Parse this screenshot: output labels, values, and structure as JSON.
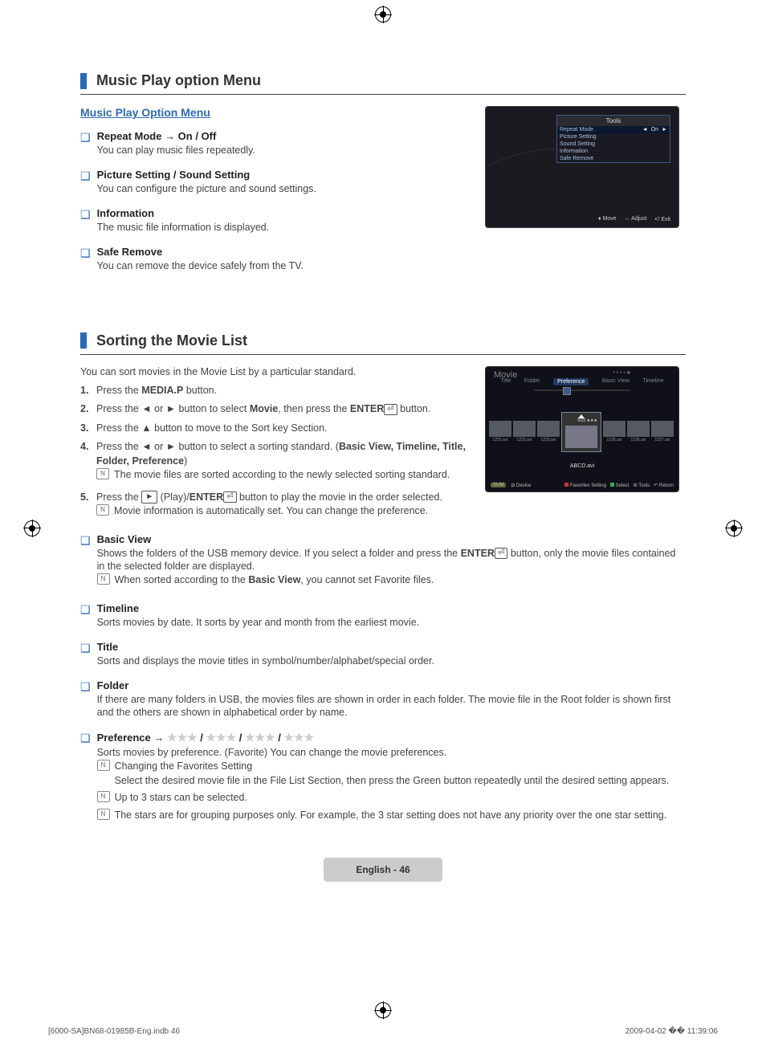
{
  "section1": {
    "title": "Music Play option Menu",
    "subtitle": "Music Play Option Menu",
    "items": [
      {
        "title": "Repeat Mode → On / Off",
        "desc": "You can play music files repeatedly."
      },
      {
        "title": "Picture Setting / Sound Setting",
        "desc": "You can configure the picture and sound settings."
      },
      {
        "title": "Information",
        "desc": "The music file information is displayed."
      },
      {
        "title": "Safe Remove",
        "desc": "You can remove the device safely from the TV."
      }
    ]
  },
  "tools_shot": {
    "header": "Tools",
    "rows": [
      {
        "label": "Repeat Mode",
        "value": "On",
        "selected": true
      },
      {
        "label": "Picture Setting",
        "value": "",
        "selected": false
      },
      {
        "label": "Sound Setting",
        "value": "",
        "selected": false
      },
      {
        "label": "Information",
        "value": "",
        "selected": false
      },
      {
        "label": "Safe Remove",
        "value": "",
        "selected": false
      }
    ],
    "footer": {
      "move": "Move",
      "adjust": "Adjust",
      "exit": "Exit"
    }
  },
  "section2": {
    "title": "Sorting the Movie List",
    "intro": "You can sort movies in the Movie List by a particular standard.",
    "steps": {
      "s1": {
        "num": "1.",
        "text_a": "Press the ",
        "b1": "MEDIA.P",
        "text_b": " button."
      },
      "s2": {
        "num": "2.",
        "text_a": "Press the ◄ or ► button to select ",
        "b1": "Movie",
        "text_b": ", then press the ",
        "b2": "ENTER",
        "text_c": " button."
      },
      "s3": {
        "num": "3.",
        "text_a": "Press the ▲ button to move to the Sort key Section."
      },
      "s4": {
        "num": "4.",
        "text_a": "Press the ◄ or ► button to select a sorting standard. (",
        "b1": "Basic View, Timeline, Title, Folder, Preference",
        "text_b": ")",
        "note": "The movie files are sorted according to the newly selected sorting standard."
      },
      "s5": {
        "num": "5.",
        "text_a": "Press the ",
        "play": "►",
        "text_b": " (Play)/",
        "b1": "ENTER",
        "text_c": " button to play the movie in the order selected.",
        "note": "Movie information is automatically set. You can change the preference."
      }
    },
    "items": {
      "basic_view": {
        "title": "Basic View",
        "desc_a": "Shows the folders of the USB memory device. If you select a folder and press the ",
        "b1": "ENTER",
        "desc_b": " button, only the movie files contained in the selected folder are displayed.",
        "note_a": "When sorted according to the ",
        "note_b1": "Basic View",
        "note_b": ", you cannot set Favorite files."
      },
      "timeline": {
        "title": "Timeline",
        "desc": "Sorts movies by date. It sorts by year and month from the earliest movie."
      },
      "title_item": {
        "title": "Title",
        "desc": "Sorts and displays the movie titles in symbol/number/alphabet/special order."
      },
      "folder": {
        "title": "Folder",
        "desc": "If there are many folders in USB, the movies files are shown in order in each folder. The movie file in the Root folder is shown first and the others are shown in alphabetical order by name."
      },
      "preference": {
        "title_prefix": "Preference → ",
        "desc": "Sorts movies by preference. (Favorite) You can change the movie preferences.",
        "note1a": "Changing the Favorites Setting",
        "note1b": "Select the desired movie file in the File List Section, then press the Green button repeatedly until the desired setting appears.",
        "note2": "Up to 3 stars can be selected.",
        "note3": "The stars are for grouping purposes only. For example, the 3 star setting does not have any priority over the one star setting."
      }
    }
  },
  "movie_shot": {
    "title": "Movie",
    "tabs": [
      "Title",
      "Folder",
      "Preference",
      "Basic View",
      "Timeline"
    ],
    "active_tab": "Preference",
    "thumbs_left": [
      "1231.avi",
      "1232.avi",
      "1233.avi"
    ],
    "center": "ABCD.avi",
    "center_top": "5/15  ★★★",
    "thumbs_right": [
      "1235.avi",
      "1236.avi",
      "1237.avi"
    ],
    "footer_left": {
      "sum": "SUM",
      "device": "Device"
    },
    "footer_right": {
      "fav": "Favorites Setting",
      "select": "Select",
      "tools": "Tools",
      "ret": "Return"
    }
  },
  "page_footer": "English - 46",
  "meta": {
    "left": "[6000-SA]BN68-01985B-Eng.indb   46",
    "right": "2009-04-02   �� 11:39:06"
  }
}
